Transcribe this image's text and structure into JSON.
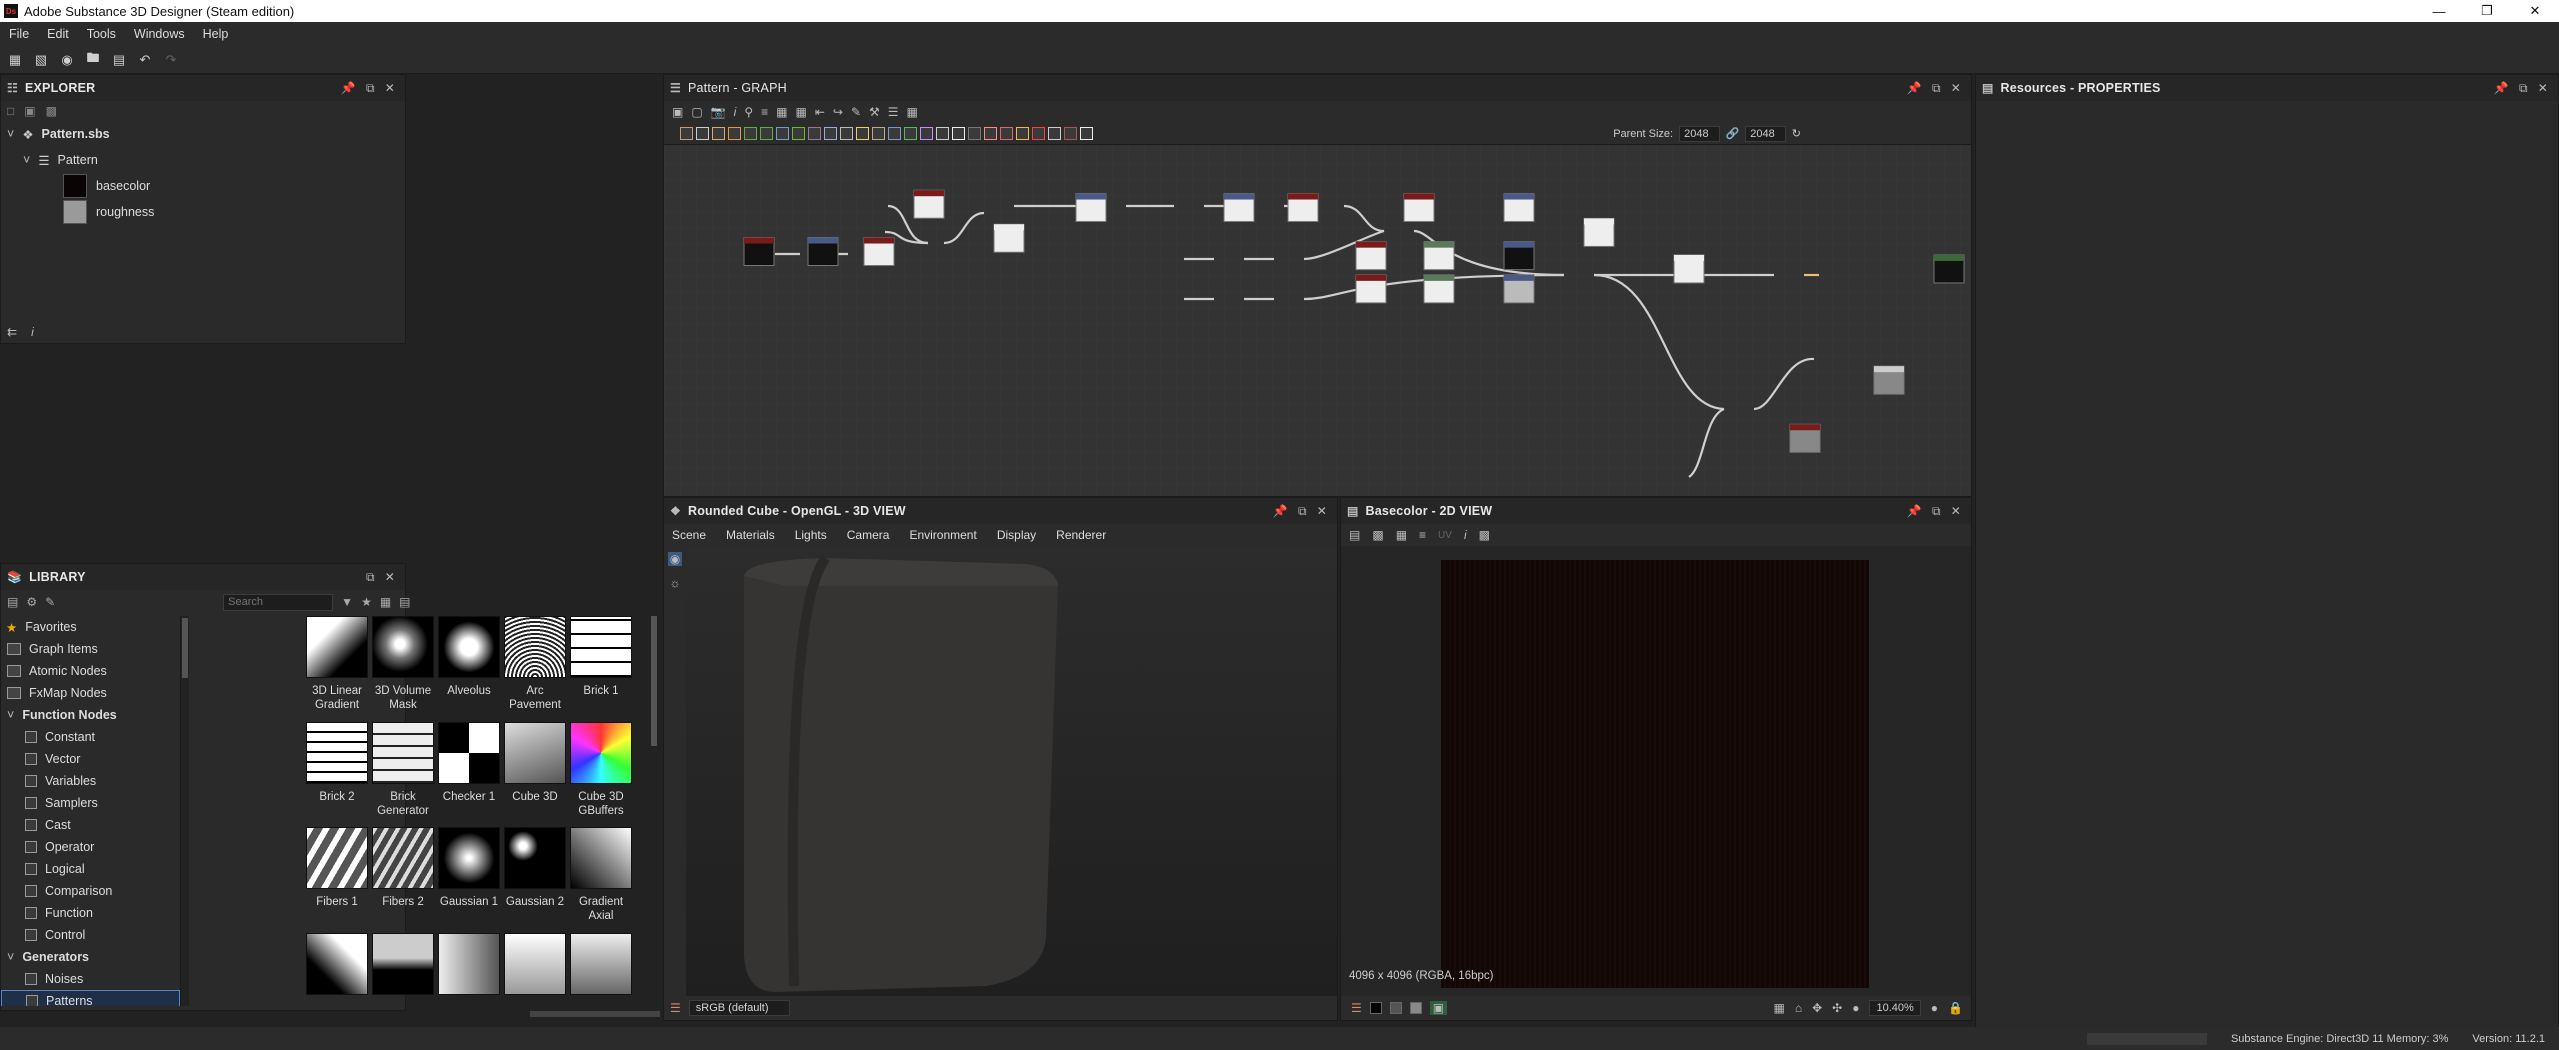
{
  "window": {
    "title": "Adobe Substance 3D Designer (Steam edition)",
    "app_badge": "Ds"
  },
  "menu": [
    "File",
    "Edit",
    "Tools",
    "Windows",
    "Help"
  ],
  "explorer": {
    "title": "EXPLORER",
    "file": "Pattern.sbs",
    "graph": "Pattern",
    "outputs": [
      {
        "label": "basecolor",
        "color": "#0a0404"
      },
      {
        "label": "roughness",
        "color": "#9a9a9a"
      }
    ]
  },
  "library": {
    "title": "LIBRARY",
    "search_placeholder": "Search",
    "categories": [
      {
        "label": "Favorites",
        "type": "cat",
        "icon": "star-icon"
      },
      {
        "label": "Graph Items",
        "type": "cat"
      },
      {
        "label": "Atomic Nodes",
        "type": "cat"
      },
      {
        "label": "FxMap Nodes",
        "type": "cat"
      },
      {
        "label": "Function Nodes",
        "type": "header"
      },
      {
        "label": "Constant",
        "type": "sub"
      },
      {
        "label": "Vector",
        "type": "sub"
      },
      {
        "label": "Variables",
        "type": "sub"
      },
      {
        "label": "Samplers",
        "type": "sub"
      },
      {
        "label": "Cast",
        "type": "sub"
      },
      {
        "label": "Operator",
        "type": "sub"
      },
      {
        "label": "Logical",
        "type": "sub"
      },
      {
        "label": "Comparison",
        "type": "sub"
      },
      {
        "label": "Function",
        "type": "sub"
      },
      {
        "label": "Control",
        "type": "sub"
      },
      {
        "label": "Generators",
        "type": "header"
      },
      {
        "label": "Noises",
        "type": "sub"
      },
      {
        "label": "Patterns",
        "type": "sub",
        "selected": true
      }
    ],
    "thumbnails": [
      {
        "label": "3D Linear Gradient",
        "style": "linear-gradient(135deg,#fff 30%,#000 70%)"
      },
      {
        "label": "3D Volume Mask",
        "style": "radial-gradient(circle at 45% 45%,#fff 10%,#777 30%,#000 60%)"
      },
      {
        "label": "Alveolus",
        "style": "radial-gradient(circle,#fff 20%,#000 60%)"
      },
      {
        "label": "Arc Pavement",
        "style": "repeating-radial-gradient(circle at 50% 100%,#fff 0 2px,#222 2px 4px)"
      },
      {
        "label": "Brick 1",
        "style": "repeating-linear-gradient(0deg,#000 0 2px,#fff 2px 14px)"
      },
      {
        "label": "Brick 2",
        "style": "repeating-linear-gradient(0deg,#000 0 2px,#fff 2px 10px)"
      },
      {
        "label": "Brick Generator",
        "style": "repeating-linear-gradient(0deg,#222 0 2px,#eee 2px 12px)"
      },
      {
        "label": "Checker 1",
        "style": "conic-gradient(#fff 25%,#000 0 50%,#fff 0 75%,#000 0)"
      },
      {
        "label": "Cube 3D",
        "style": "linear-gradient(160deg,#ddd,#555)"
      },
      {
        "label": "Cube 3D GBuffers",
        "style": "conic-gradient(#f33,#ff3,#3f3,#3ff,#33f,#f3f,#f33)"
      },
      {
        "label": "Fibers 1",
        "style": "repeating-linear-gradient(120deg,#fff 0 6px,#555 6px 14px)"
      },
      {
        "label": "Fibers 2",
        "style": "repeating-linear-gradient(120deg,#ddd 0 4px,#444 4px 10px)"
      },
      {
        "label": "Gaussian 1",
        "style": "radial-gradient(circle,#fff 5%,#000 60%)"
      },
      {
        "label": "Gaussian 2",
        "style": "radial-gradient(circle at 30% 30%,#fff 6%,#000 25%)"
      },
      {
        "label": "Gradient Axial",
        "style": "linear-gradient(45deg,#000,#fff)"
      },
      {
        "label": "",
        "style": "linear-gradient(45deg,#000 30%,#fff 70%)"
      },
      {
        "label": "",
        "style": "linear-gradient(0deg,#000 40%,#ccc 60%)"
      },
      {
        "label": "",
        "style": "linear-gradient(90deg,#eee,#555)"
      },
      {
        "label": "",
        "style": "linear-gradient(0deg,#999,#fff)"
      },
      {
        "label": "",
        "style": "linear-gradient(0deg,#666,#eee)"
      }
    ]
  },
  "graph": {
    "title": "Pattern - GRAPH",
    "parent_size_label": "Parent Size:",
    "parent_size_value": "2048",
    "output_size_value": "2048"
  },
  "view3d": {
    "title": "Rounded Cube - OpenGL - 3D VIEW",
    "menu": [
      "Scene",
      "Materials",
      "Lights",
      "Camera",
      "Environment",
      "Display",
      "Renderer"
    ],
    "colorspace": "sRGB (default)"
  },
  "view2d": {
    "title": "Basecolor - 2D VIEW",
    "channel_select": "UV",
    "info": "4096 x 4096 (RGBA, 16bpc)",
    "zoom": "10.40%"
  },
  "properties": {
    "title": "Resources - PROPERTIES"
  },
  "statusbar": {
    "engine": "Substance Engine: Direct3D 11  Memory: 3%",
    "version": "Version: 11.2.1"
  }
}
